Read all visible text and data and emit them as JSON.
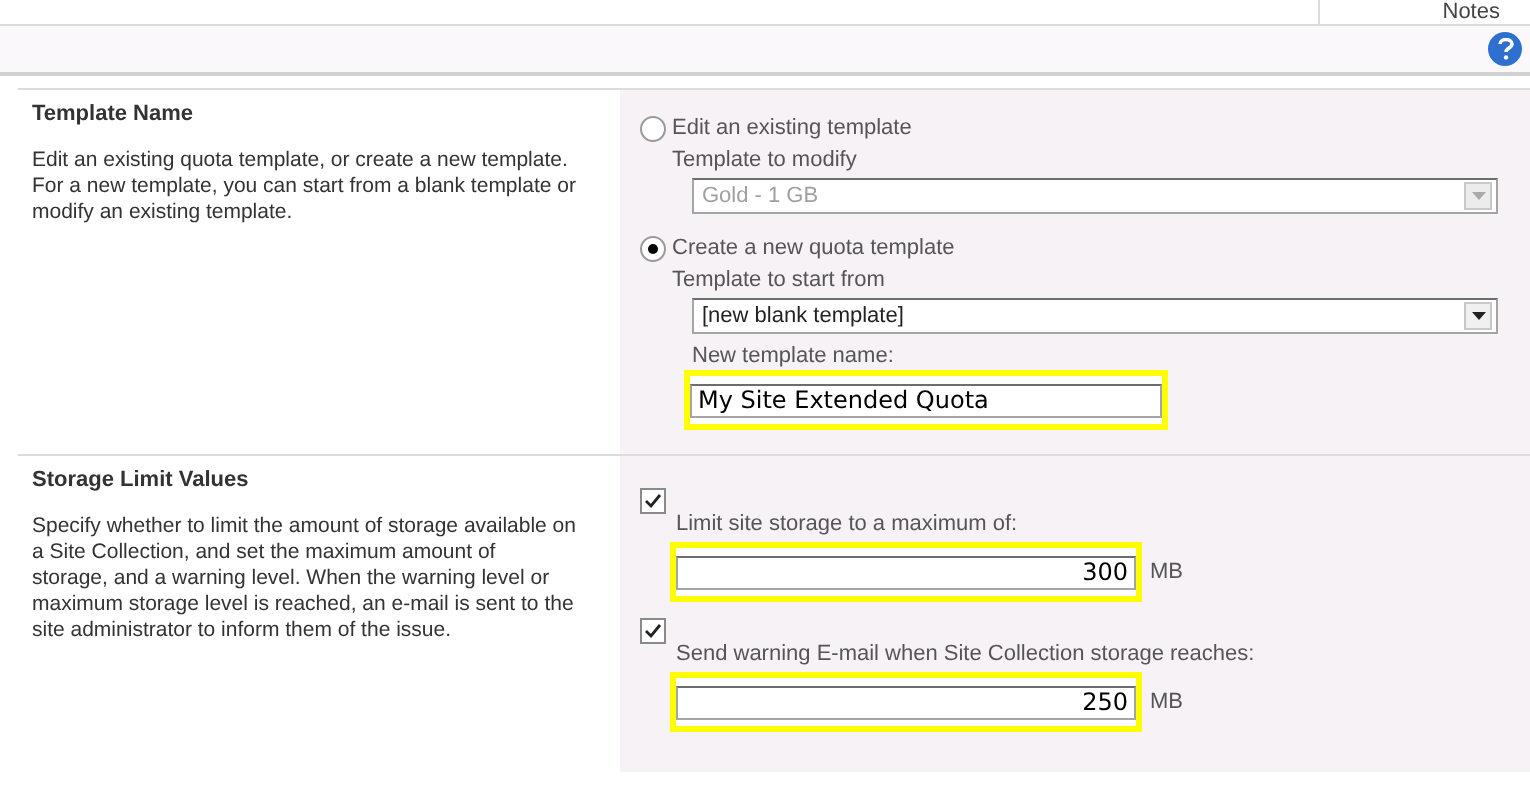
{
  "top_bar": {
    "notes_label": "Notes"
  },
  "sections": [
    {
      "kind": "template",
      "title": "Template Name",
      "description": "Edit an existing quota template, or create a new template. For a new template, you can start from a blank template or modify an existing template.",
      "options": [
        {
          "label": "Edit an existing template",
          "selected": false,
          "select_label": "Template to modify",
          "select_value": "Gold - 1 GB",
          "disabled": true
        },
        {
          "label": "Create a new quota template",
          "selected": true,
          "select_label": "Template to start from",
          "select_value": "[new blank template]",
          "disabled": false
        }
      ],
      "name_field": {
        "label": "New template name:",
        "value": "My Site Extended Quota"
      }
    },
    {
      "kind": "storage",
      "title": "Storage Limit Values",
      "description": "Specify whether to limit the amount of storage available on a Site Collection, and set the maximum amount of storage, and a warning level. When the warning level or maximum storage level is reached, an e-mail is sent to the site administrator to inform them of the issue.",
      "limits": [
        {
          "label": "Limit site storage to a maximum of:",
          "checked": true,
          "value": "300",
          "unit": "MB"
        },
        {
          "label": "Send warning E-mail when Site Collection storage reaches:",
          "checked": true,
          "value": "250",
          "unit": "MB"
        }
      ]
    }
  ]
}
